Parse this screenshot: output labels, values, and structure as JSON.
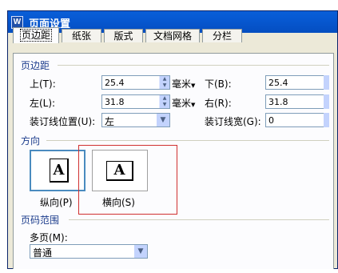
{
  "dialog": {
    "icon": "W",
    "title": "页面设置",
    "tabs": [
      "页边距",
      "纸张",
      "版式",
      "文档网格",
      "分栏"
    ],
    "margins": {
      "section_label": "页边距",
      "top_label": "上(T):",
      "top_value": "25.4",
      "bottom_label": "下(B):",
      "bottom_value": "25.4",
      "left_label": "左(L):",
      "left_value": "31.8",
      "right_label": "右(R):",
      "right_value": "31.8",
      "unit": "毫米",
      "gutter_pos_label": "装订线位置(U):",
      "gutter_pos_value": "左",
      "gutter_width_label": "装订线宽(G):",
      "gutter_width_value": "0"
    },
    "orientation": {
      "section_label": "方向",
      "paper_glyph": "A",
      "portrait_label": "纵向(P)",
      "landscape_label": "横向(S)"
    },
    "pages": {
      "section_label": "页码范围",
      "multiple_label": "多页(M):",
      "multiple_value": "普通"
    }
  }
}
